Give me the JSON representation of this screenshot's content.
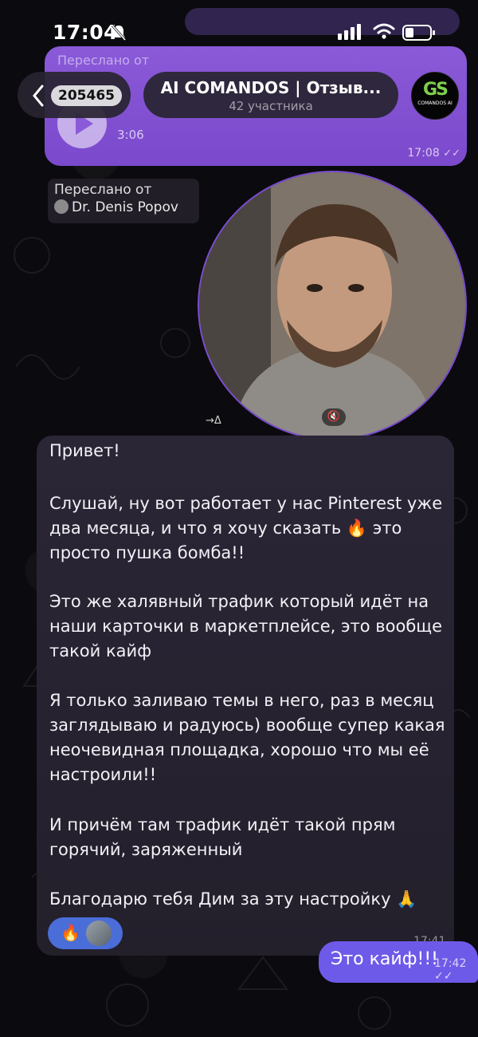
{
  "status_bar": {
    "time": "17:04"
  },
  "background_message": {
    "forwarded_label": "Переслано от",
    "duration": "3:06",
    "time": "17:08"
  },
  "header": {
    "back_count": "205465",
    "title": "AI COMANDOS | Отзыв...",
    "subtitle": "42 участника",
    "avatar_logo": "GS",
    "avatar_text": "COMANDOS AI"
  },
  "video_message": {
    "forwarded_label": "Переслано от",
    "forwarded_author": "Dr. Denis Popov",
    "meta": "→Δ",
    "mute_icon": "speaker-muted-icon"
  },
  "text_message": {
    "lines": [
      "Привет!",
      "",
      "Слушай, ну вот работает у нас Pinterest уже",
      "два месяца, и что я хочу сказать 🔥 это",
      "просто пушка бомба!!",
      "",
      "Это же халявный трафик который идёт на",
      "наши карточки в маркетплейсе, это вообще",
      "такой кайф",
      "",
      "Я только заливаю темы в него, раз в месяц",
      "заглядываю и радуюсь) вообще супер какая",
      "неочевидная площадка, хорошо что мы её",
      "настроили!!",
      "",
      "И причём там трафик идёт такой прям",
      "горячий, заряженный",
      "",
      "Благодарю тебя Дим за эту настройку 🙏"
    ],
    "reaction_emoji": "🔥",
    "time": "17:41"
  },
  "outgoing_message": {
    "text": "Это кайф!!!",
    "time": "17:42"
  },
  "colors": {
    "accent_purple": "#7b49cc",
    "outgoing_bubble": "#6e5ae8",
    "reaction_blue": "#4a6dd8"
  }
}
